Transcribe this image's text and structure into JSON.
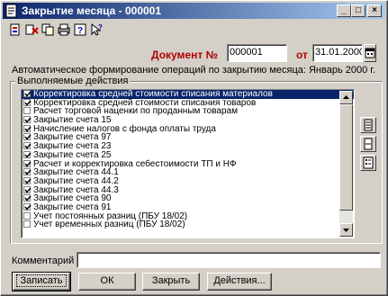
{
  "window": {
    "title": "Закрытие месяца - 000001",
    "controls": {
      "minimize": "_",
      "maximize": "□",
      "close": "×"
    }
  },
  "toolbar": {
    "icons": [
      "new-document-icon",
      "delete-icon",
      "copy-icon",
      "print-icon",
      "help-icon",
      "pointer-help-icon"
    ]
  },
  "document": {
    "label": "Документ №",
    "number": "000001",
    "date_prefix": "от",
    "date": "31.01.2000"
  },
  "auto_text": "Автоматическое формирование операций по закрытию месяца: Январь 2000 г.",
  "actions_group": {
    "label": "Выполняемые действия",
    "items": [
      {
        "checked": true,
        "selected": true,
        "label": "Корректировка средней стоимости списания материалов"
      },
      {
        "checked": true,
        "selected": false,
        "label": "Корректировка средней стоимости списания товаров"
      },
      {
        "checked": false,
        "selected": false,
        "label": "Расчет торговой наценки по проданным товарам"
      },
      {
        "checked": true,
        "selected": false,
        "label": "Закрытие счета 15"
      },
      {
        "checked": true,
        "selected": false,
        "label": "Начисление налогов с фонда оплаты труда"
      },
      {
        "checked": true,
        "selected": false,
        "label": "Закрытие счета 97"
      },
      {
        "checked": true,
        "selected": false,
        "label": "Закрытие счета 23"
      },
      {
        "checked": true,
        "selected": false,
        "label": "Закрытие счета 25"
      },
      {
        "checked": true,
        "selected": false,
        "label": "Расчет и корректировка себестоимости ТП и НФ"
      },
      {
        "checked": true,
        "selected": false,
        "label": "Закрытие счета 44.1"
      },
      {
        "checked": true,
        "selected": false,
        "label": "Закрытие счета 44.2"
      },
      {
        "checked": true,
        "selected": false,
        "label": "Закрытие счета 44.3"
      },
      {
        "checked": true,
        "selected": false,
        "label": "Закрытие счета 90"
      },
      {
        "checked": true,
        "selected": false,
        "label": "Закрытие счета 91"
      },
      {
        "checked": false,
        "selected": false,
        "label": "Учет постоянных разниц (ПБУ 18/02)"
      },
      {
        "checked": false,
        "selected": false,
        "label": "Учет временных разниц (ПБУ 18/02)"
      }
    ]
  },
  "side_buttons": [
    "select-all-icon",
    "deselect-all-icon",
    "settings-icon"
  ],
  "comment": {
    "label": "Комментарий",
    "value": ""
  },
  "buttons": {
    "save": "Записать",
    "ok": "ОК",
    "close": "Закрыть",
    "actions": "Действия..."
  },
  "colors": {
    "title_start": "#0a246a",
    "title_end": "#a6caf0",
    "label_red": "#b00000",
    "selection": "#0a246a",
    "face": "#d4d0c8"
  }
}
